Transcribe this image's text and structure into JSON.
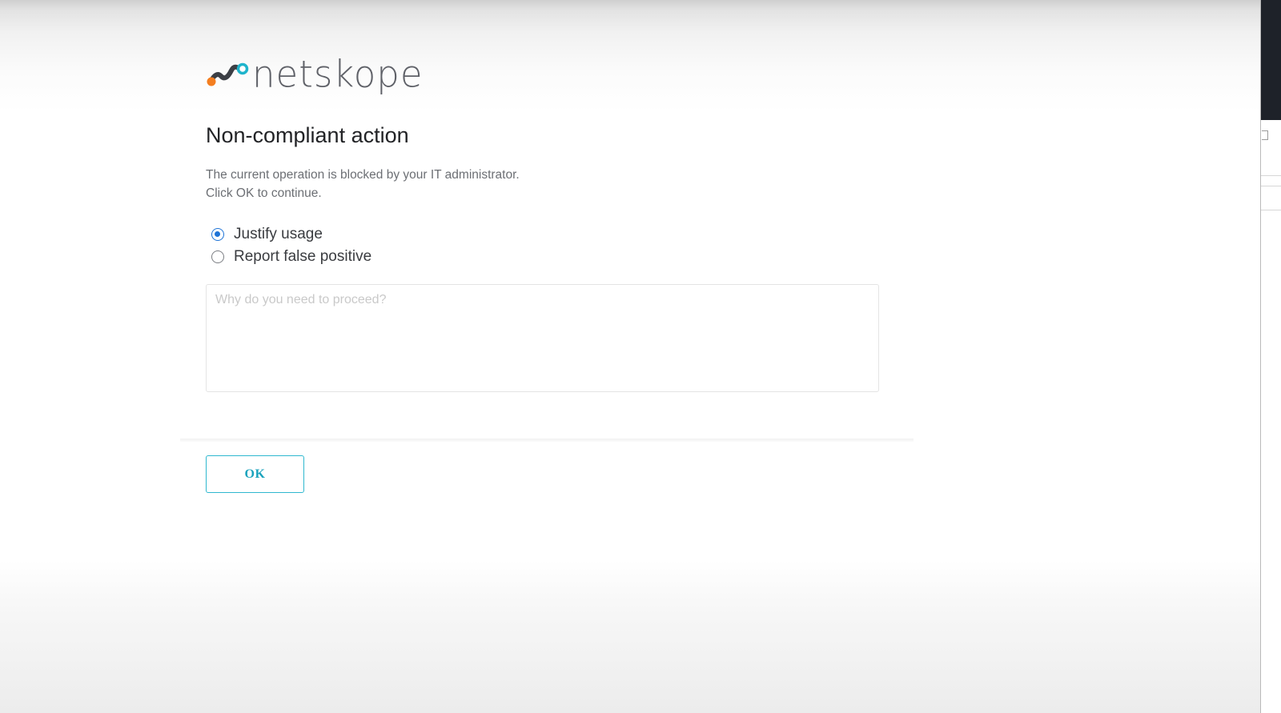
{
  "brand": {
    "name": "netskope",
    "icon": "netskope-logo-icon",
    "colors": {
      "orange": "#f47e20",
      "dark": "#3c3f45",
      "teal": "#1fb4cc",
      "text": "#5f6168"
    }
  },
  "dialog": {
    "title": "Non-compliant action",
    "message_line1": "The current operation is blocked by your IT administrator.",
    "message_line2": "Click OK to continue.",
    "options": [
      {
        "label": "Justify usage",
        "checked": true
      },
      {
        "label": "Report false positive",
        "checked": false
      }
    ],
    "reason": {
      "value": "",
      "placeholder": "Why do you need to proceed?"
    },
    "ok_label": "OK"
  },
  "colors": {
    "accent_radio": "#1f74d6",
    "ok_border": "#2fb8cf",
    "ok_text": "#1aa3bd"
  }
}
